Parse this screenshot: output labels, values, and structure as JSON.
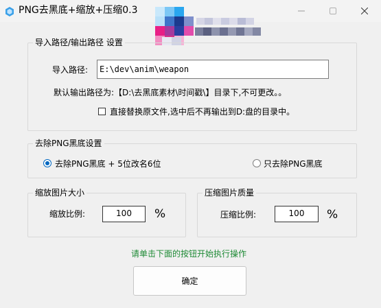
{
  "window": {
    "title": "PNG去黑底+缩放+压缩0.3"
  },
  "path_group": {
    "legend": "导入路径/输出路径 设置",
    "import_label": "导入路径:",
    "import_value": "E:\\dev\\anim\\weapon",
    "default_output_note": "默认输出路径为:【D:\\去黑底素材\\时间戳\\】目录下,不可更改。。",
    "replace_checkbox_label": "直接替换原文件,选中后不再输出到D:盘的目录中。",
    "replace_checked": false
  },
  "remove_group": {
    "legend": "去除PNG黑底设置",
    "option1_label": "去除PNG黑底 + 5位改名6位",
    "option1_selected": true,
    "option2_label": "只去除PNG黑底",
    "option2_selected": false
  },
  "scale_group": {
    "legend": "缩放图片大小",
    "ratio_label": "缩放比例:",
    "ratio_value": "100",
    "unit": "%"
  },
  "compress_group": {
    "legend": "压缩图片质量",
    "ratio_label": "压缩比例:",
    "ratio_value": "100",
    "unit": "%"
  },
  "hint": "请单击下面的按钮开始执行操作",
  "confirm_label": "确定",
  "colors": {
    "hint_green": "#1e8a35",
    "radio_blue": "#0067c0"
  }
}
